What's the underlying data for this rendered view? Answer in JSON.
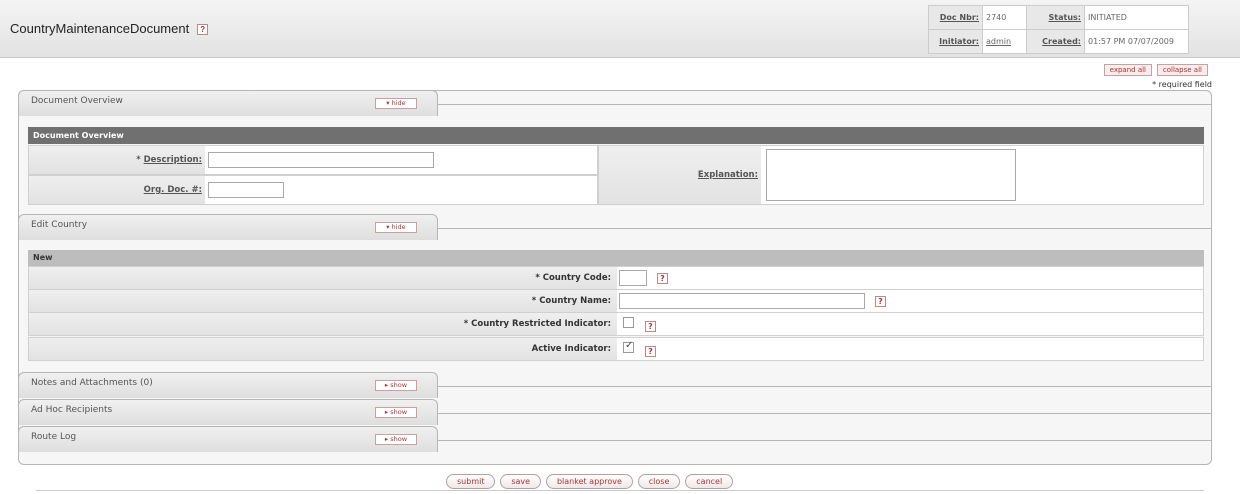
{
  "header": {
    "title": "CountryMaintenanceDocument",
    "help": "?",
    "doc_nbr_label": "Doc Nbr:",
    "doc_nbr_value": "2740",
    "status_label": "Status:",
    "status_value": "INITIATED",
    "initiator_label": "Initiator:",
    "initiator_value": "admin",
    "created_label": "Created:",
    "created_value": "01:57 PM 07/07/2009"
  },
  "top_buttons": {
    "expand_all": "expand all",
    "collapse_all": "collapse all"
  },
  "required_note": "* required field",
  "tabs": {
    "document_overview": {
      "label": "Document Overview",
      "toggle": "▾ hide"
    },
    "edit_country": {
      "label": "Edit Country",
      "toggle": "▾ hide"
    },
    "notes": {
      "label": "Notes and Attachments (0)",
      "toggle": "▸ show"
    },
    "adhoc": {
      "label": "Ad Hoc Recipients",
      "toggle": "▸ show"
    },
    "route_log": {
      "label": "Route Log",
      "toggle": "▸ show"
    }
  },
  "overview": {
    "section_title": "Document Overview",
    "description_label": "Description:",
    "org_doc_label": "Org. Doc. #:",
    "explanation_label": "Explanation:",
    "description_value": "",
    "org_doc_value": "",
    "explanation_value": ""
  },
  "edit_country": {
    "section_title": "New",
    "country_code_label": "Country Code:",
    "country_name_label": "Country Name:",
    "restricted_label": "Country Restricted Indicator:",
    "active_label": "Active Indicator:",
    "country_code_value": "",
    "country_name_value": "",
    "restricted_checked": false,
    "active_checked": true
  },
  "bottom_buttons": {
    "submit": "submit",
    "save": "save",
    "blanket_approve": "blanket approve",
    "close": "close",
    "cancel": "cancel"
  }
}
